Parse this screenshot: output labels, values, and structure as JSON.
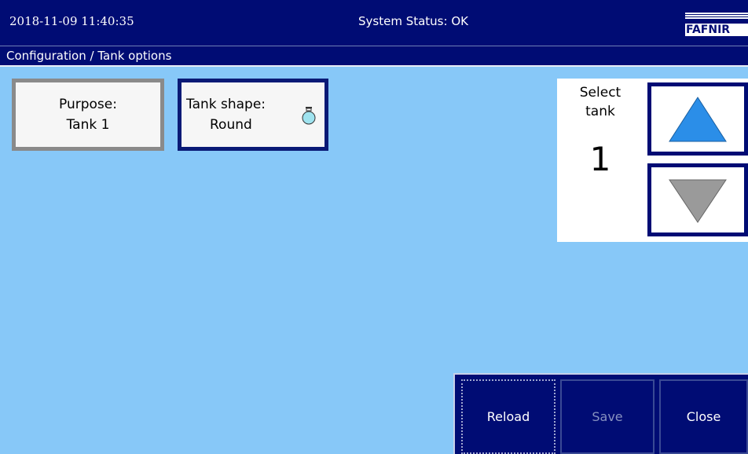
{
  "header": {
    "datetime": "2018-11-09  11:40:35",
    "status": "System Status: OK",
    "logo_text": "FAFNIR"
  },
  "breadcrumb": "Configuration / Tank options",
  "options": {
    "purpose_label": "Purpose:",
    "purpose_value": "Tank 1",
    "shape_label": "Tank shape:",
    "shape_value": "Round",
    "shape_icon": "round-tank-icon"
  },
  "select_tank": {
    "label_line1": "Select",
    "label_line2": "tank",
    "value": "1",
    "up_icon": "arrow-up-icon",
    "down_icon": "arrow-down-icon"
  },
  "buttons": {
    "reload": "Reload",
    "save": "Save",
    "close": "Close"
  },
  "colors": {
    "background": "#87c8f8",
    "header": "#000c74",
    "up_arrow": "#2b8ee8",
    "down_arrow": "#9a9a9a"
  }
}
